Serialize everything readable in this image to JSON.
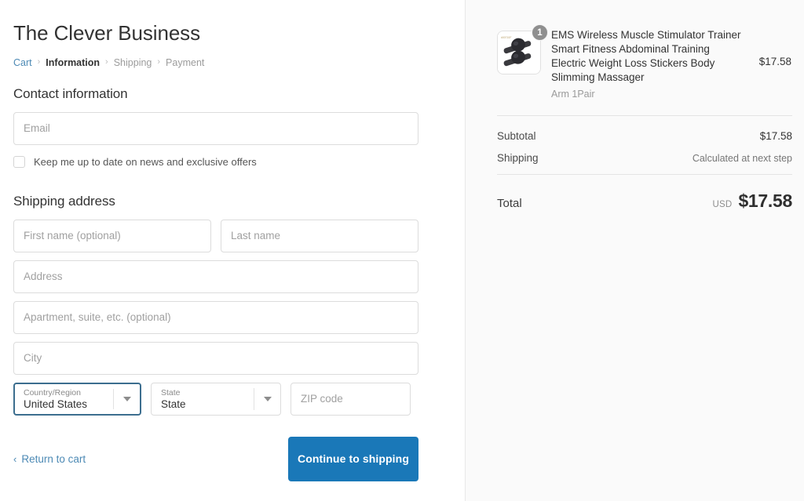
{
  "store": {
    "name": "The Clever Business"
  },
  "breadcrumb": {
    "separator": "›",
    "items": [
      {
        "label": "Cart",
        "state": "link"
      },
      {
        "label": "Information",
        "state": "current"
      },
      {
        "label": "Shipping",
        "state": "future"
      },
      {
        "label": "Payment",
        "state": "future"
      }
    ]
  },
  "contact": {
    "heading": "Contact information",
    "email_placeholder": "Email",
    "optin_label": "Keep me up to date on news and exclusive offers",
    "optin_checked": false
  },
  "shipping": {
    "heading": "Shipping address",
    "first_name_placeholder": "First name (optional)",
    "last_name_placeholder": "Last name",
    "address_placeholder": "Address",
    "apartment_placeholder": "Apartment, suite, etc. (optional)",
    "city_placeholder": "City",
    "country": {
      "label": "Country/Region",
      "value": "United States",
      "focused": true
    },
    "state": {
      "label": "State",
      "value": "State",
      "focused": false
    },
    "zip_placeholder": "ZIP code"
  },
  "actions": {
    "return_to_cart": "Return to cart",
    "return_chevron": "‹",
    "continue_button": "Continue to shipping"
  },
  "summary": {
    "item": {
      "quantity": "1",
      "title": "EMS Wireless Muscle Stimulator Trainer Smart Fitness Abdominal Training Electric Weight Loss Stickers Body Slimming Massager",
      "variant": "Arm 1Pair",
      "price": "$17.58"
    },
    "subtotal_label": "Subtotal",
    "subtotal_value": "$17.58",
    "shipping_label": "Shipping",
    "shipping_value": "Calculated at next step",
    "total_label": "Total",
    "total_currency": "USD",
    "total_value": "$17.58"
  },
  "colors": {
    "accent_button": "#1a78b8",
    "link": "#4d8ab5",
    "focus_border": "#3c6e8f",
    "summary_bg": "#fafafa"
  }
}
